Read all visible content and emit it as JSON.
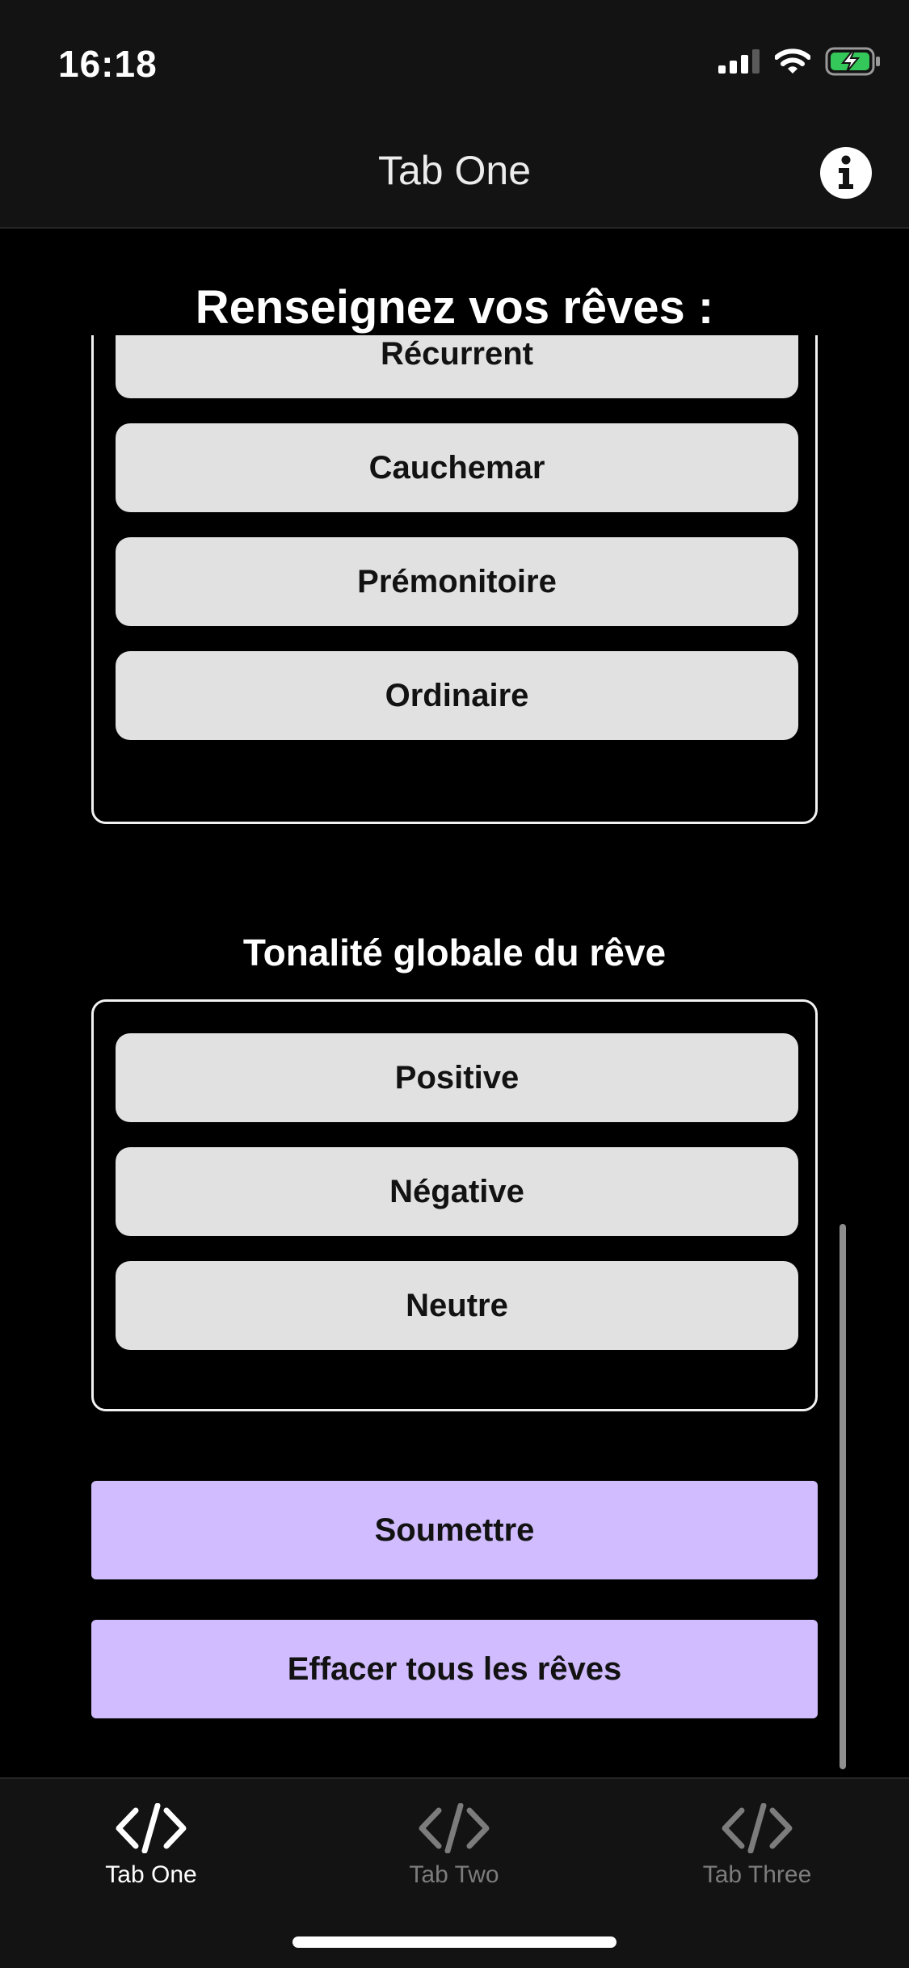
{
  "status": {
    "time": "16:18"
  },
  "header": {
    "title": "Tab One"
  },
  "form": {
    "title": "Renseignez vos rêves :",
    "type_options": [
      "Récurrent",
      "Cauchemar",
      "Prémonitoire",
      "Ordinaire"
    ],
    "tone_title": "Tonalité globale du rêve",
    "tone_options": [
      "Positive",
      "Négative",
      "Neutre"
    ],
    "submit_label": "Soumettre",
    "clear_label": "Effacer tous les rêves"
  },
  "tabs": [
    {
      "label": "Tab One",
      "icon": "code-icon",
      "active": true
    },
    {
      "label": "Tab Two",
      "icon": "code-icon",
      "active": false
    },
    {
      "label": "Tab Three",
      "icon": "code-icon",
      "active": false
    }
  ],
  "colors": {
    "accent": "#d0bcfe",
    "option_bg": "#e1e1e1",
    "bar_bg": "#131313",
    "inactive_tab": "#7c7c7c"
  }
}
